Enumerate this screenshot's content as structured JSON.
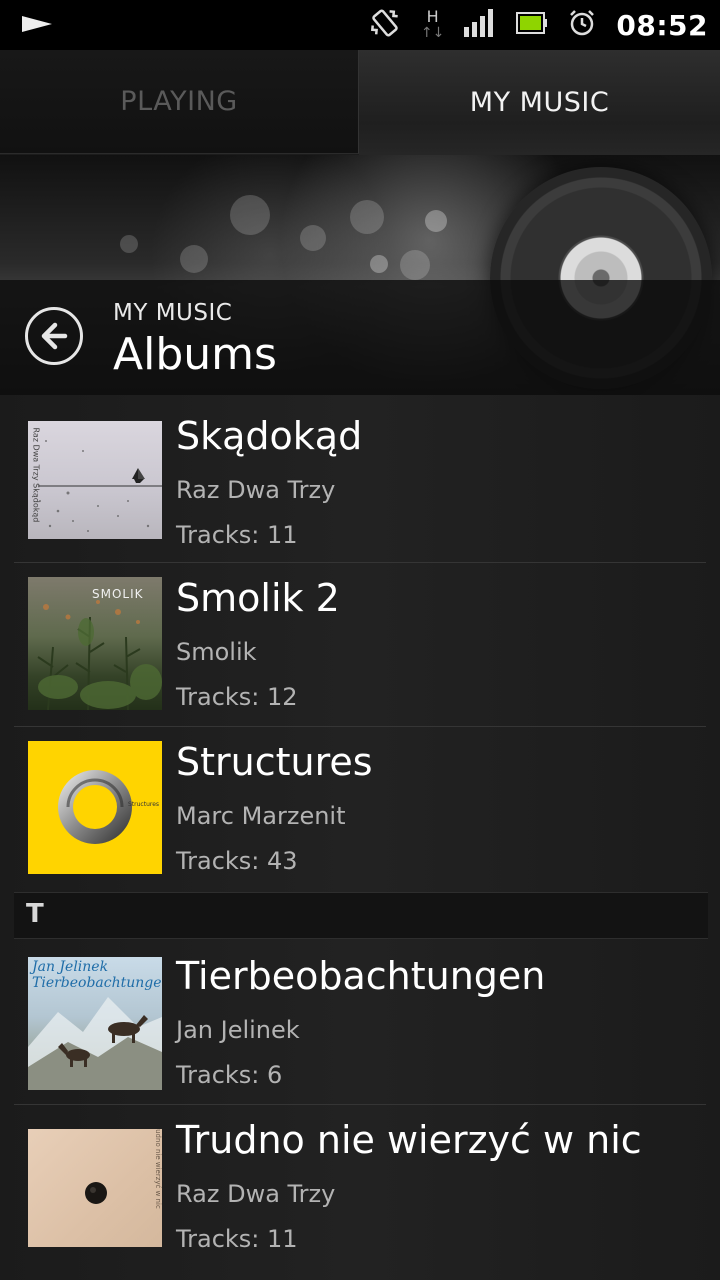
{
  "status_bar": {
    "time": "08:52",
    "network_type": "H",
    "icons": [
      "play-notification-icon",
      "vibrate-icon",
      "data-arrows-icon",
      "signal-icon",
      "battery-icon",
      "alarm-icon"
    ]
  },
  "tabs": [
    {
      "label": "PLAYING",
      "active": false
    },
    {
      "label": "MY MUSIC",
      "active": true
    }
  ],
  "header": {
    "subtitle": "MY MUSIC",
    "title": "Albums"
  },
  "albums": [
    {
      "title": "Skądokąd",
      "artist": "Raz Dwa Trzy",
      "tracks": "Tracks: 11",
      "cover_text": "Raz Dwa Trzy  Skądokąd"
    },
    {
      "title": "Smolik 2",
      "artist": "Smolik",
      "tracks": "Tracks: 12",
      "cover_text": "SMOLIK"
    },
    {
      "title": "Structures",
      "artist": "Marc Marzenit",
      "tracks": "Tracks: 43",
      "cover_text": "Structures"
    },
    {
      "title": "Tierbeobachtungen",
      "artist": "Jan Jelinek",
      "tracks": "Tracks: 6",
      "cover_text": "Jan Jelinek Tierbeobachtungen"
    },
    {
      "title": "Trudno nie wierzyć w nic",
      "artist": "Raz Dwa Trzy",
      "tracks": "Tracks: 11",
      "cover_text": "Trudno nie wierzyć w nic"
    }
  ],
  "section_letter": "T",
  "colors": {
    "background": "#1c1c1c",
    "status_bar": "#000000",
    "structures_cover": "#ffd400",
    "secondary_text": "#b3b3b3"
  }
}
